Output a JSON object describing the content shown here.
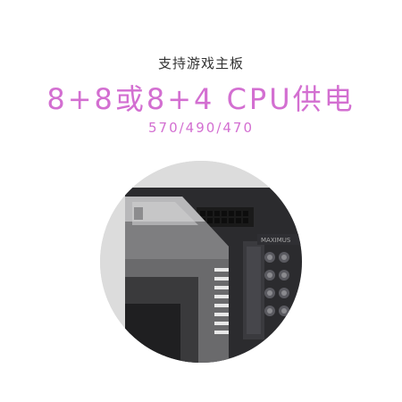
{
  "header": {
    "subtitle": "支持游戏主板",
    "headline": "8+8或8+4 CPU供电",
    "chipsets": "570/490/470"
  },
  "colors": {
    "accent": "#d36fd1",
    "subtitle_text": "#333333",
    "circle_bg": "#dedede"
  },
  "image": {
    "subject": "motherboard-vrm-heatsink",
    "board_marking": "MAXIMUS"
  }
}
